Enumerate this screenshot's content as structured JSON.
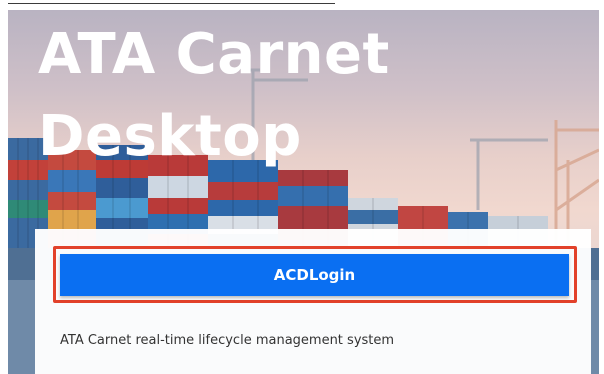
{
  "hero": {
    "title_line1": "ATA Carnet",
    "title_line2": "Desktop"
  },
  "login": {
    "button_label": "ACDLogin",
    "description": "ATA Carnet real-time lifecycle management system"
  },
  "colors": {
    "button": "#0a6ff2",
    "highlight_frame": "#e2412a",
    "title_text": "#ffffff"
  }
}
